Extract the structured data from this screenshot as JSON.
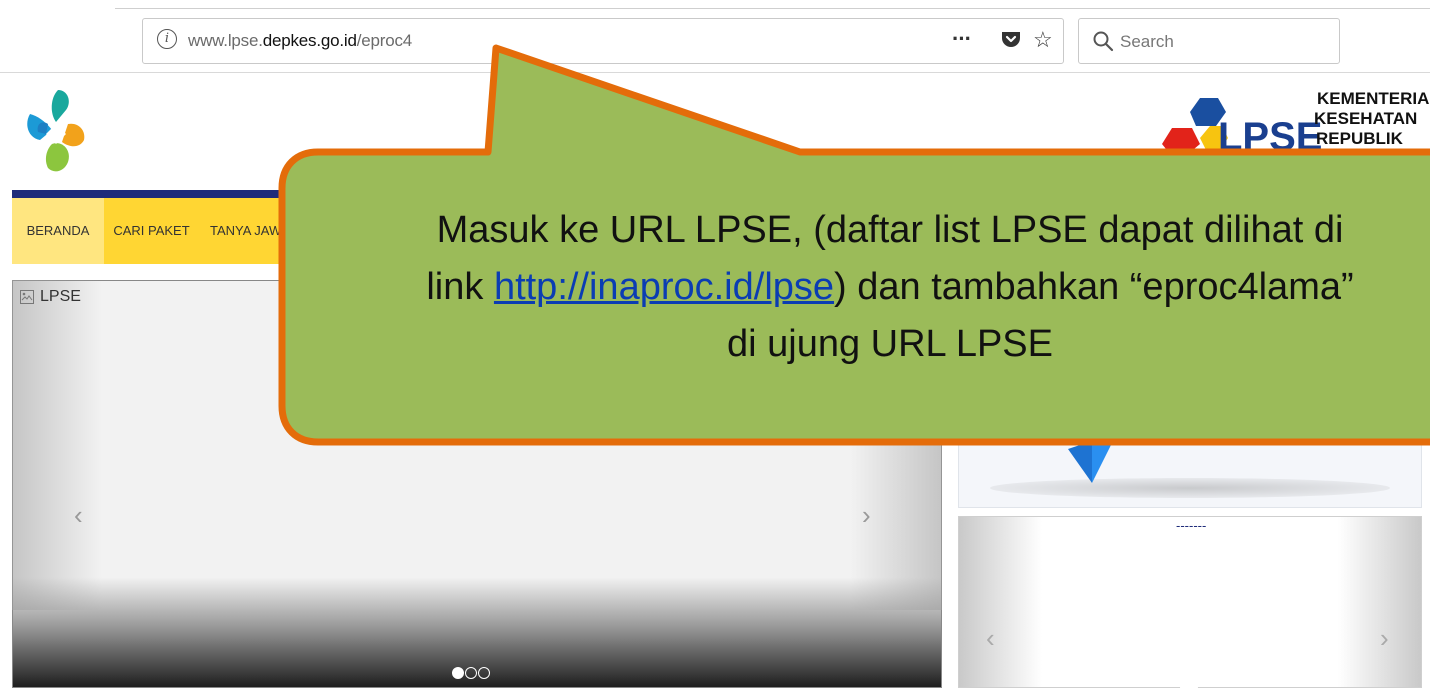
{
  "browser": {
    "url_prefix": "www.lpse.",
    "url_domain": "depkes.go.id",
    "url_path": "/eproc4",
    "more_label": "···",
    "star_label": "☆",
    "info_label": "i",
    "search_placeholder": "Search"
  },
  "header": {
    "logo_text_line1": "KEMENTERIAN",
    "logo_text_line2": "KESEHATAN",
    "logo_text_line3": "REPUBLIK",
    "lpse_word": "LPSE"
  },
  "nav": {
    "items": [
      {
        "label": "BERANDA"
      },
      {
        "label": "CARI PAKET"
      },
      {
        "label": "TANYA JAWAB"
      }
    ]
  },
  "main_panel": {
    "title": "LPSE",
    "prev_label": "‹",
    "next_label": "›",
    "slides_total": 3,
    "active_slide": 1
  },
  "side_panel": {
    "title": "-------",
    "prev_label": "‹",
    "next_label": "›"
  },
  "callout": {
    "line1": "Masuk ke URL LPSE, (daftar list LPSE dapat dilihat di",
    "line2_pre": "link ",
    "line2_link": "http://inaproc.id/lpse",
    "line2_post": ") dan tambahkan  “eproc4lama”",
    "line3": "di ujung URL LPSE",
    "fill_color": "#9bbb59",
    "border_color": "#e46c0a"
  },
  "colors": {
    "nav_blue": "#1f2c7a",
    "nav_yellow": "#ffd633"
  }
}
